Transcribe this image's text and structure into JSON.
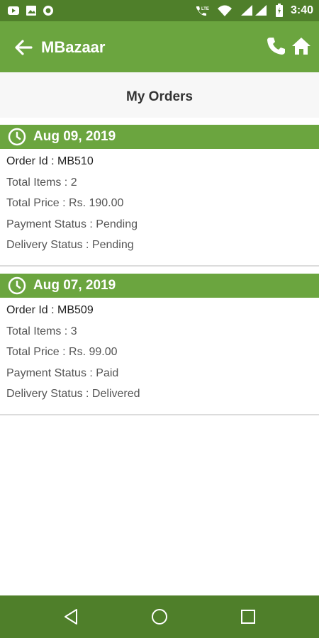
{
  "status_bar": {
    "time": "3:40",
    "network": "LTE"
  },
  "app_bar": {
    "title": "MBazaar"
  },
  "page": {
    "title": "My Orders"
  },
  "orders": [
    {
      "date": "Aug 09, 2019",
      "order_id_label": "Order Id : MB510",
      "total_items_label": "Total Items : 2",
      "total_price_label": "Total Price : Rs. 190.00",
      "payment_status_label": "Payment Status : Pending",
      "delivery_status_label": "Delivery Status : Pending"
    },
    {
      "date": "Aug 07, 2019",
      "order_id_label": "Order Id : MB509",
      "total_items_label": "Total Items : 3",
      "total_price_label": "Total Price : Rs. 99.00",
      "payment_status_label": "Payment Status : Paid",
      "delivery_status_label": "Delivery Status : Delivered"
    }
  ],
  "colors": {
    "primary": "#6ba53f",
    "primary_dark": "#4f7f2a"
  },
  "icons": [
    "youtube-icon",
    "image-icon",
    "record-icon",
    "volte-icon",
    "wifi-icon",
    "signal-icon",
    "battery-icon",
    "back-arrow-icon",
    "phone-icon",
    "home-icon",
    "clock-icon",
    "nav-back-icon",
    "nav-home-icon",
    "nav-recents-icon"
  ]
}
